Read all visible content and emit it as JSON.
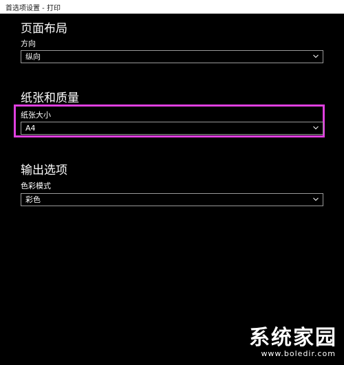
{
  "window": {
    "title": "首选项设置 - 打印"
  },
  "page_layout": {
    "heading": "页面布局",
    "orientation_label": "方向",
    "orientation_value": "纵向"
  },
  "paper_quality": {
    "heading": "纸张和质量",
    "size_label": "纸张大小",
    "size_value": "A4"
  },
  "output_options": {
    "heading": "输出选项",
    "color_mode_label": "色彩模式",
    "color_mode_value": "彩色"
  },
  "watermark": {
    "text": "系统家园",
    "url": "www.boledir.com"
  },
  "colors": {
    "background": "#000000",
    "highlight": "#e040e0",
    "select_border": "#9a9a9a",
    "text": "#ffffff"
  }
}
